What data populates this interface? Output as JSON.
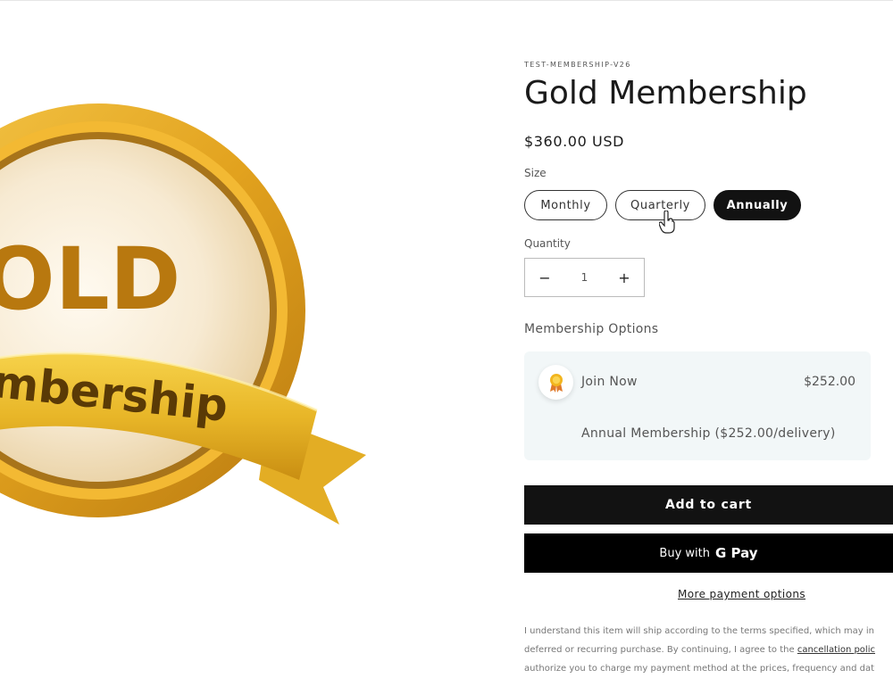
{
  "product": {
    "sku": "TEST-MEMBERSHIP-V26",
    "title": "Gold Membership",
    "price": "$360.00 USD"
  },
  "image": {
    "badge_text": "OLD",
    "ribbon_text": "mbership"
  },
  "size": {
    "label": "Size",
    "options": [
      "Monthly",
      "Quarterly",
      "Annually"
    ],
    "selected": "Annually"
  },
  "quantity": {
    "label": "Quantity",
    "minus": "−",
    "value": "1",
    "plus": "+"
  },
  "membership_options": {
    "label": "Membership Options",
    "option": {
      "name": "Join Now",
      "price": "$252.00",
      "description": "Annual Membership ($252.00/delivery)",
      "icon": "award-ribbon-icon"
    }
  },
  "buttons": {
    "add_to_cart": "Add to cart",
    "buy_with": "Buy with",
    "gpay": "G Pay",
    "more_payment": "More payment options"
  },
  "terms": {
    "line1": "I understand this item will ship according to the terms specified, which may in",
    "line2_pre": "deferred or recurring purchase. By continuing, I agree to the",
    "line2_link": "cancellation polic",
    "line3": "authorize you to charge my payment method at the prices, frequency and dat"
  },
  "colors": {
    "button_bg": "#121212",
    "option_box_bg": "#f2f7f8",
    "gold": "#d9a21b"
  }
}
